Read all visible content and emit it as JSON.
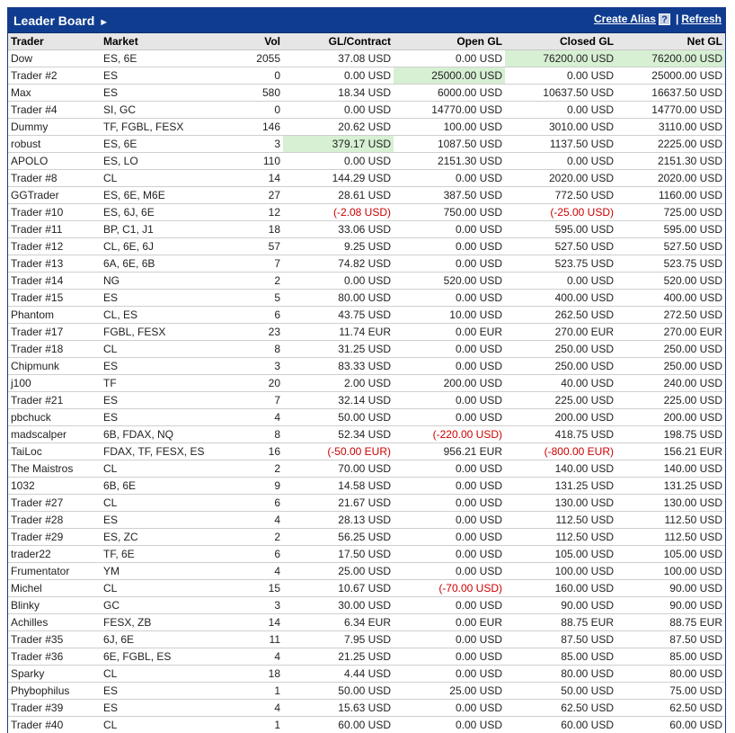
{
  "header": {
    "title": "Leader Board",
    "title_arrow": "►",
    "create_alias": "Create Alias",
    "help": "?",
    "separator": "|",
    "refresh": "Refresh"
  },
  "columns": [
    "Trader",
    "Market",
    "Vol",
    "GL/Contract",
    "Open GL",
    "Closed GL",
    "Net GL"
  ],
  "rows": [
    {
      "trader": "Dow",
      "market": "ES, 6E",
      "vol": "2055",
      "glc": "37.08 USD",
      "open": "0.00 USD",
      "closed": "76200.00 USD",
      "net": "76200.00 USD",
      "hl": [
        "closed",
        "net"
      ]
    },
    {
      "trader": "Trader #2",
      "market": "ES",
      "vol": "0",
      "glc": "0.00 USD",
      "open": "25000.00 USD",
      "closed": "0.00 USD",
      "net": "25000.00 USD",
      "hl": [
        "open"
      ]
    },
    {
      "trader": "Max",
      "market": "ES",
      "vol": "580",
      "glc": "18.34 USD",
      "open": "6000.00 USD",
      "closed": "10637.50 USD",
      "net": "16637.50 USD"
    },
    {
      "trader": "Trader #4",
      "market": "SI, GC",
      "vol": "0",
      "glc": "0.00 USD",
      "open": "14770.00 USD",
      "closed": "0.00 USD",
      "net": "14770.00 USD"
    },
    {
      "trader": "Dummy",
      "market": "TF, FGBL, FESX",
      "vol": "146",
      "glc": "20.62 USD",
      "open": "100.00 USD",
      "closed": "3010.00 USD",
      "net": "3110.00 USD"
    },
    {
      "trader": "robust",
      "market": "ES, 6E",
      "vol": "3",
      "glc": "379.17 USD",
      "open": "1087.50 USD",
      "closed": "1137.50 USD",
      "net": "2225.00 USD",
      "hl": [
        "glc"
      ]
    },
    {
      "trader": "APOLO",
      "market": "ES, LO",
      "vol": "110",
      "glc": "0.00 USD",
      "open": "2151.30 USD",
      "closed": "0.00 USD",
      "net": "2151.30 USD"
    },
    {
      "trader": "Trader #8",
      "market": "CL",
      "vol": "14",
      "glc": "144.29 USD",
      "open": "0.00 USD",
      "closed": "2020.00 USD",
      "net": "2020.00 USD"
    },
    {
      "trader": "GGTrader",
      "market": "ES, 6E, M6E",
      "vol": "27",
      "glc": "28.61 USD",
      "open": "387.50 USD",
      "closed": "772.50 USD",
      "net": "1160.00 USD"
    },
    {
      "trader": "Trader #10",
      "market": "ES, 6J, 6E",
      "vol": "12",
      "glc": "(-2.08 USD)",
      "open": "750.00 USD",
      "closed": "(-25.00 USD)",
      "net": "725.00 USD",
      "neg": [
        "glc",
        "closed"
      ]
    },
    {
      "trader": "Trader #11",
      "market": "BP, C1, J1",
      "vol": "18",
      "glc": "33.06 USD",
      "open": "0.00 USD",
      "closed": "595.00 USD",
      "net": "595.00 USD"
    },
    {
      "trader": "Trader #12",
      "market": "CL, 6E, 6J",
      "vol": "57",
      "glc": "9.25 USD",
      "open": "0.00 USD",
      "closed": "527.50 USD",
      "net": "527.50 USD"
    },
    {
      "trader": "Trader #13",
      "market": "6A, 6E, 6B",
      "vol": "7",
      "glc": "74.82 USD",
      "open": "0.00 USD",
      "closed": "523.75 USD",
      "net": "523.75 USD"
    },
    {
      "trader": "Trader #14",
      "market": "NG",
      "vol": "2",
      "glc": "0.00 USD",
      "open": "520.00 USD",
      "closed": "0.00 USD",
      "net": "520.00 USD"
    },
    {
      "trader": "Trader #15",
      "market": "ES",
      "vol": "5",
      "glc": "80.00 USD",
      "open": "0.00 USD",
      "closed": "400.00 USD",
      "net": "400.00 USD"
    },
    {
      "trader": "Phantom",
      "market": "CL, ES",
      "vol": "6",
      "glc": "43.75 USD",
      "open": "10.00 USD",
      "closed": "262.50 USD",
      "net": "272.50 USD"
    },
    {
      "trader": "Trader #17",
      "market": "FGBL, FESX",
      "vol": "23",
      "glc": "11.74 EUR",
      "open": "0.00 EUR",
      "closed": "270.00 EUR",
      "net": "270.00 EUR"
    },
    {
      "trader": "Trader #18",
      "market": "CL",
      "vol": "8",
      "glc": "31.25 USD",
      "open": "0.00 USD",
      "closed": "250.00 USD",
      "net": "250.00 USD"
    },
    {
      "trader": "Chipmunk",
      "market": "ES",
      "vol": "3",
      "glc": "83.33 USD",
      "open": "0.00 USD",
      "closed": "250.00 USD",
      "net": "250.00 USD"
    },
    {
      "trader": "j100",
      "market": "TF",
      "vol": "20",
      "glc": "2.00 USD",
      "open": "200.00 USD",
      "closed": "40.00 USD",
      "net": "240.00 USD"
    },
    {
      "trader": "Trader #21",
      "market": "ES",
      "vol": "7",
      "glc": "32.14 USD",
      "open": "0.00 USD",
      "closed": "225.00 USD",
      "net": "225.00 USD"
    },
    {
      "trader": "pbchuck",
      "market": "ES",
      "vol": "4",
      "glc": "50.00 USD",
      "open": "0.00 USD",
      "closed": "200.00 USD",
      "net": "200.00 USD"
    },
    {
      "trader": "madscalper",
      "market": "6B, FDAX, NQ",
      "vol": "8",
      "glc": "52.34 USD",
      "open": "(-220.00 USD)",
      "closed": "418.75 USD",
      "net": "198.75 USD",
      "neg": [
        "open"
      ]
    },
    {
      "trader": "TaiLoc",
      "market": "FDAX, TF, FESX, ES",
      "vol": "16",
      "glc": "(-50.00 EUR)",
      "open": "956.21 EUR",
      "closed": "(-800.00 EUR)",
      "net": "156.21 EUR",
      "neg": [
        "glc",
        "closed"
      ]
    },
    {
      "trader": "The Maistros",
      "market": "CL",
      "vol": "2",
      "glc": "70.00 USD",
      "open": "0.00 USD",
      "closed": "140.00 USD",
      "net": "140.00 USD"
    },
    {
      "trader": "1032",
      "market": "6B, 6E",
      "vol": "9",
      "glc": "14.58 USD",
      "open": "0.00 USD",
      "closed": "131.25 USD",
      "net": "131.25 USD"
    },
    {
      "trader": "Trader #27",
      "market": "CL",
      "vol": "6",
      "glc": "21.67 USD",
      "open": "0.00 USD",
      "closed": "130.00 USD",
      "net": "130.00 USD"
    },
    {
      "trader": "Trader #28",
      "market": "ES",
      "vol": "4",
      "glc": "28.13 USD",
      "open": "0.00 USD",
      "closed": "112.50 USD",
      "net": "112.50 USD"
    },
    {
      "trader": "Trader #29",
      "market": "ES, ZC",
      "vol": "2",
      "glc": "56.25 USD",
      "open": "0.00 USD",
      "closed": "112.50 USD",
      "net": "112.50 USD"
    },
    {
      "trader": "trader22",
      "market": "TF, 6E",
      "vol": "6",
      "glc": "17.50 USD",
      "open": "0.00 USD",
      "closed": "105.00 USD",
      "net": "105.00 USD"
    },
    {
      "trader": "Frumentator",
      "market": "YM",
      "vol": "4",
      "glc": "25.00 USD",
      "open": "0.00 USD",
      "closed": "100.00 USD",
      "net": "100.00 USD"
    },
    {
      "trader": "Michel",
      "market": "CL",
      "vol": "15",
      "glc": "10.67 USD",
      "open": "(-70.00 USD)",
      "closed": "160.00 USD",
      "net": "90.00 USD",
      "neg": [
        "open"
      ]
    },
    {
      "trader": "Blinky",
      "market": "GC",
      "vol": "3",
      "glc": "30.00 USD",
      "open": "0.00 USD",
      "closed": "90.00 USD",
      "net": "90.00 USD"
    },
    {
      "trader": "Achilles",
      "market": "FESX, ZB",
      "vol": "14",
      "glc": "6.34 EUR",
      "open": "0.00 EUR",
      "closed": "88.75 EUR",
      "net": "88.75 EUR"
    },
    {
      "trader": "Trader #35",
      "market": "6J, 6E",
      "vol": "11",
      "glc": "7.95 USD",
      "open": "0.00 USD",
      "closed": "87.50 USD",
      "net": "87.50 USD"
    },
    {
      "trader": "Trader #36",
      "market": "6E, FGBL, ES",
      "vol": "4",
      "glc": "21.25 USD",
      "open": "0.00 USD",
      "closed": "85.00 USD",
      "net": "85.00 USD"
    },
    {
      "trader": "Sparky",
      "market": "CL",
      "vol": "18",
      "glc": "4.44 USD",
      "open": "0.00 USD",
      "closed": "80.00 USD",
      "net": "80.00 USD"
    },
    {
      "trader": "Phybophilus",
      "market": "ES",
      "vol": "1",
      "glc": "50.00 USD",
      "open": "25.00 USD",
      "closed": "50.00 USD",
      "net": "75.00 USD"
    },
    {
      "trader": "Trader #39",
      "market": "ES",
      "vol": "4",
      "glc": "15.63 USD",
      "open": "0.00 USD",
      "closed": "62.50 USD",
      "net": "62.50 USD"
    },
    {
      "trader": "Trader #40",
      "market": "CL",
      "vol": "1",
      "glc": "60.00 USD",
      "open": "0.00 USD",
      "closed": "60.00 USD",
      "net": "60.00 USD"
    }
  ]
}
